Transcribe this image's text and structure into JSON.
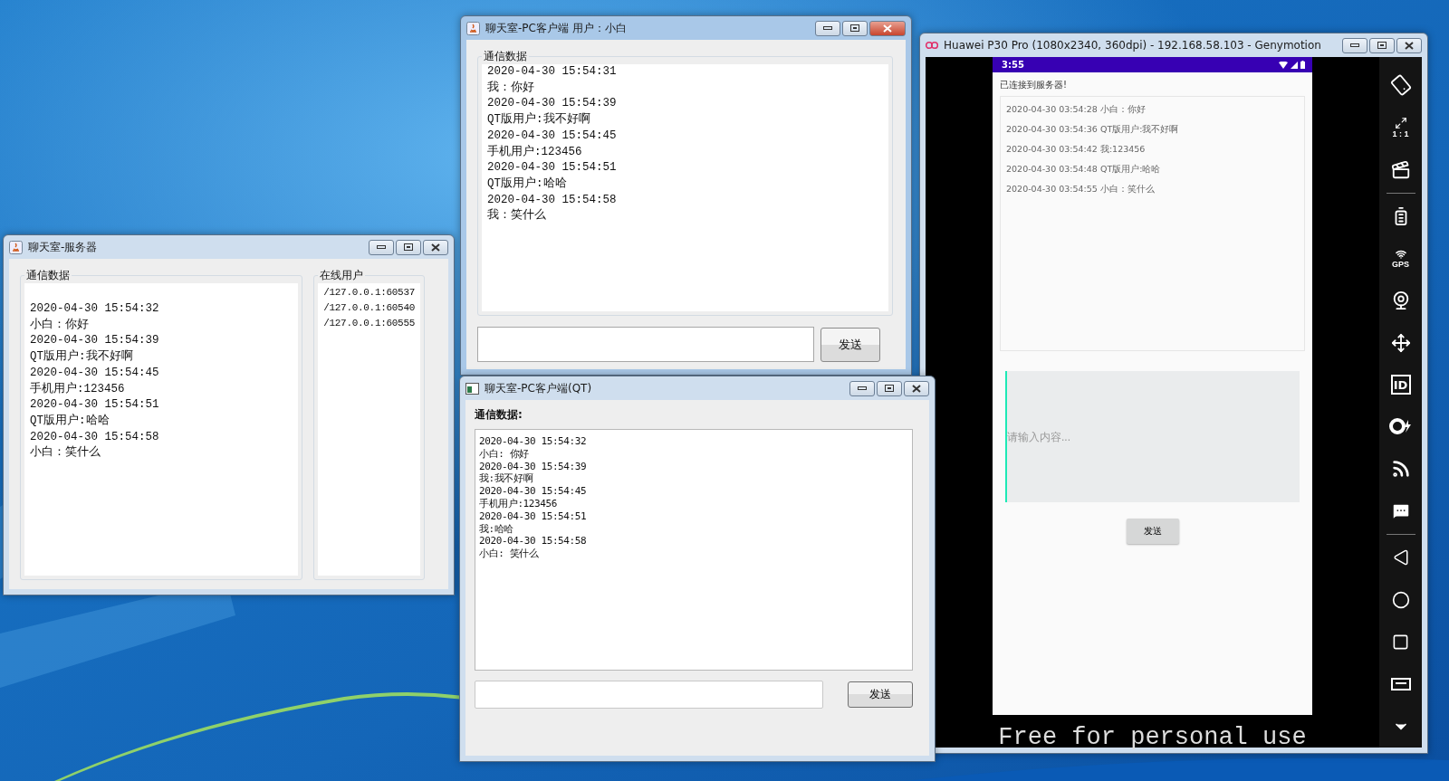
{
  "windows": [
    {
      "kind": "swing-server",
      "title": "聊天室-服务器",
      "active": false,
      "log_label": "通信数据",
      "log": [
        "2020-04-30 15:54:32",
        "小白：你好",
        "2020-04-30 15:54:39",
        "QT版用户:我不好啊",
        "2020-04-30 15:54:45",
        "手机用户:123456",
        "2020-04-30 15:54:51",
        "QT版用户:哈哈",
        "2020-04-30 15:54:58",
        "小白：笑什么"
      ],
      "users_label": "在线用户",
      "users": [
        "/127.0.0.1:60537",
        "/127.0.0.1:60540",
        "/127.0.0.1:60555"
      ]
    },
    {
      "kind": "swing-client",
      "title": "聊天室-PC客户端  用户：小白",
      "active": true,
      "log_label": "通信数据",
      "log": [
        "2020-04-30 15:54:31",
        "我：你好",
        "2020-04-30 15:54:39",
        "QT版用户:我不好啊",
        "2020-04-30 15:54:45",
        "手机用户:123456",
        "2020-04-30 15:54:51",
        "QT版用户:哈哈",
        "2020-04-30 15:54:58",
        "我：笑什么"
      ],
      "send": "发送"
    },
    {
      "kind": "emulator",
      "title": "Huawei P30 Pro (1080x2340, 360dpi) - 192.168.58.103 - Genymotion",
      "active": false,
      "clock": "3:55",
      "status": "已连接到服务器!",
      "messages": [
        "2020-04-30 03:54:28  小白：你好",
        "2020-04-30 03:54:36  QT版用户:我不好啊",
        "2020-04-30 03:54:42  我:123456",
        "2020-04-30 03:54:48  QT版用户:哈哈",
        "2020-04-30 03:54:55  小白：笑什么"
      ],
      "placeholder": "请输入内容...",
      "send": "发送",
      "license": "Free for personal use",
      "sidebar": [
        {
          "kind": "rotate"
        },
        {
          "kind": "scale",
          "label": "1 : 1"
        },
        {
          "kind": "capture"
        },
        {
          "kind": "divider"
        },
        {
          "kind": "battery"
        },
        {
          "kind": "gps",
          "label": "GPS"
        },
        {
          "kind": "camera"
        },
        {
          "kind": "dpad"
        },
        {
          "kind": "identifiers",
          "label": "ID"
        },
        {
          "kind": "disk"
        },
        {
          "kind": "network"
        },
        {
          "kind": "sms"
        },
        {
          "kind": "divider"
        },
        {
          "kind": "back"
        },
        {
          "kind": "home"
        },
        {
          "kind": "recent"
        },
        {
          "kind": "menu"
        },
        {
          "kind": "more"
        }
      ]
    },
    {
      "kind": "qt-client",
      "title": "聊天室-PC客户端(QT)",
      "active": false,
      "log_label": "通信数据:",
      "log": [
        "2020-04-30 15:54:32",
        "小白: 你好",
        "2020-04-30 15:54:39",
        "我:我不好啊",
        "2020-04-30 15:54:45",
        "手机用户:123456",
        "2020-04-30 15:54:51",
        "我:哈哈",
        "2020-04-30 15:54:58",
        "小白: 笑什么"
      ],
      "send": "发送"
    }
  ]
}
